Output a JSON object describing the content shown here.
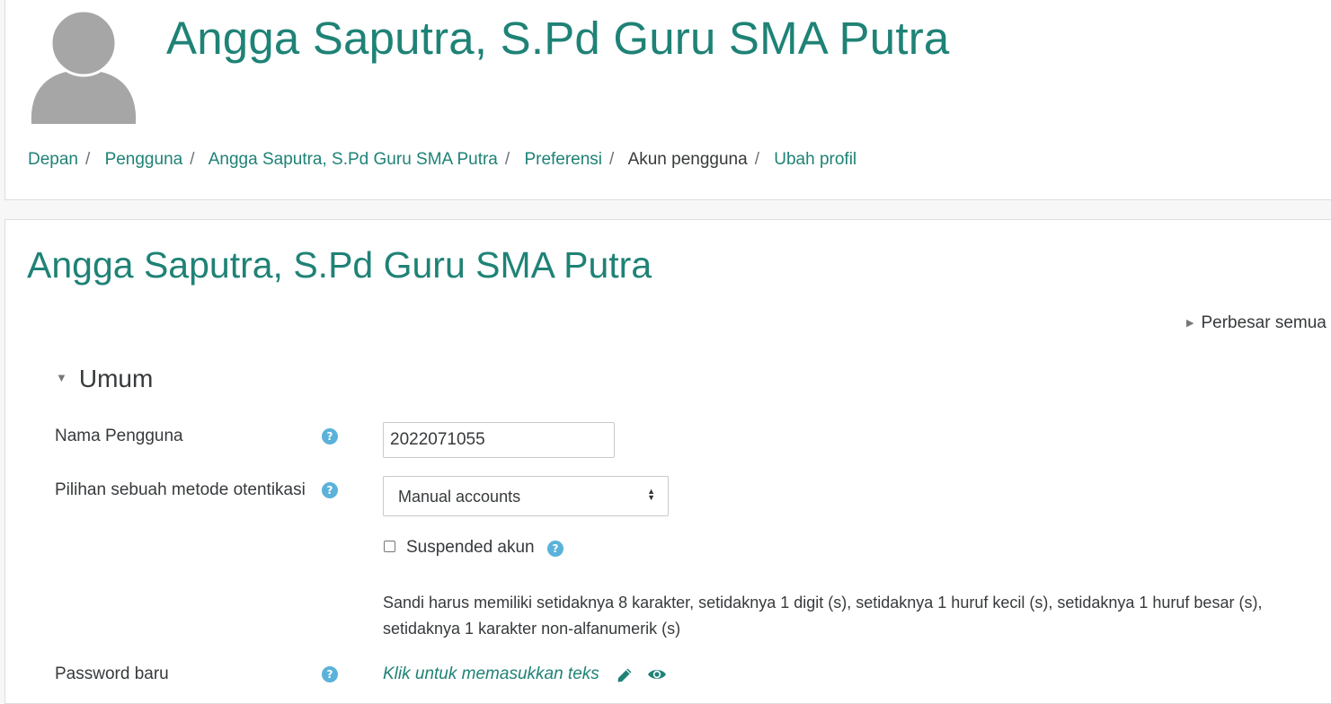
{
  "header": {
    "title": "Angga Saputra, S.Pd Guru SMA Putra",
    "avatar_icon": "user-avatar-icon"
  },
  "breadcrumb": {
    "items": [
      "Depan",
      "Pengguna",
      "Angga Saputra, S.Pd Guru SMA Putra",
      "Preferensi",
      "Akun pengguna",
      "Ubah profil"
    ],
    "separator": "/"
  },
  "main": {
    "title": "Angga Saputra, S.Pd Guru SMA Putra",
    "expand_all": "Perbesar semua",
    "section": "Umum"
  },
  "form": {
    "username_label": "Nama Pengguna",
    "username_value": "2022071055",
    "auth_label": "Pilihan sebuah metode otentikasi",
    "auth_value": "Manual accounts",
    "suspended_label": "Suspended akun",
    "suspended_checked": false,
    "password_rules": "Sandi harus memiliki setidaknya 8 karakter, setidaknya 1 digit (s), setidaknya 1 huruf kecil (s), setidaknya 1 huruf besar (s), setidaknya 1 karakter non-alfanumerik (s)",
    "new_password_label": "Password baru",
    "new_password_link": "Klik untuk memasukkan teks",
    "help_icon": "question-circle-icon"
  },
  "colors": {
    "accent": "#1f8276",
    "help": "#5bb2d9",
    "text": "#373a3c"
  }
}
